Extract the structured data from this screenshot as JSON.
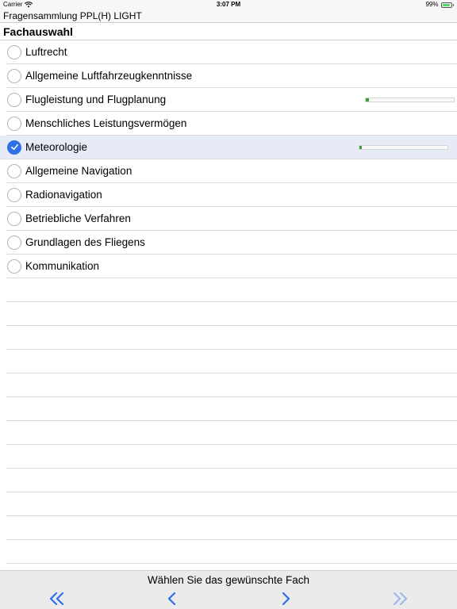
{
  "status_bar": {
    "carrier": "Carrier",
    "time": "3:07 PM",
    "battery_percent": "99%",
    "battery_level": 0.99
  },
  "app": {
    "title": "Fragensammlung PPL(H) LIGHT"
  },
  "header": {
    "title": "Fachauswahl"
  },
  "subjects": [
    {
      "label": "Luftrecht",
      "checked": false,
      "progress": null
    },
    {
      "label": "Allgemeine Luftfahrzeugkenntnisse",
      "checked": false,
      "progress": null
    },
    {
      "label": "Flugleistung und Flugplanung",
      "checked": false,
      "progress": 0.04
    },
    {
      "label": "Menschliches Leistungsvermögen",
      "checked": false,
      "progress": null
    },
    {
      "label": "Meteorologie",
      "checked": true,
      "progress": 0.03
    },
    {
      "label": "Allgemeine Navigation",
      "checked": false,
      "progress": null
    },
    {
      "label": "Radionavigation",
      "checked": false,
      "progress": null
    },
    {
      "label": "Betriebliche Verfahren",
      "checked": false,
      "progress": null
    },
    {
      "label": "Grundlagen des Fliegens",
      "checked": false,
      "progress": null
    },
    {
      "label": "Kommunikation",
      "checked": false,
      "progress": null
    }
  ],
  "footer": {
    "prompt": "Wählen Sie das gewünschte Fach",
    "buttons": [
      {
        "name": "first-page-button",
        "icon": "double-chevron-left-icon",
        "enabled": true
      },
      {
        "name": "previous-page-button",
        "icon": "chevron-left-icon",
        "enabled": true
      },
      {
        "name": "next-page-button",
        "icon": "chevron-right-icon",
        "enabled": true
      },
      {
        "name": "last-page-button",
        "icon": "double-chevron-right-icon",
        "enabled": false
      }
    ]
  },
  "colors": {
    "accent": "#2f6fe8",
    "selected_row": "#e6ebf6",
    "progress": "#3e9e33",
    "disabled": "#9fb8ea"
  }
}
